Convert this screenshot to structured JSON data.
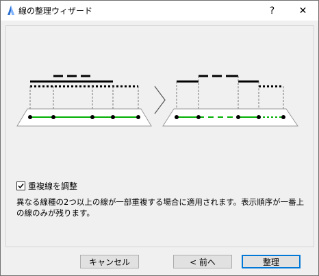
{
  "window": {
    "title": "線の整理ウィザード",
    "help_label": "?",
    "close_label": "✕"
  },
  "option": {
    "checkbox_label": "重複線を調整",
    "checked": true,
    "description": "異なる線種の2つ以上の線が一部重複する場合に適用されます。表示順序が一番上の線のみが残ります。"
  },
  "buttons": {
    "cancel_label": "キャンセル",
    "back_label": "< 前へ",
    "finish_label": "整理"
  },
  "colors": {
    "green_line": "#00b000",
    "accent_border": "#0078d7"
  },
  "icons": {
    "app": "archicad-icon",
    "arrow": "chevron-right-icon",
    "check": "checkmark-icon"
  }
}
